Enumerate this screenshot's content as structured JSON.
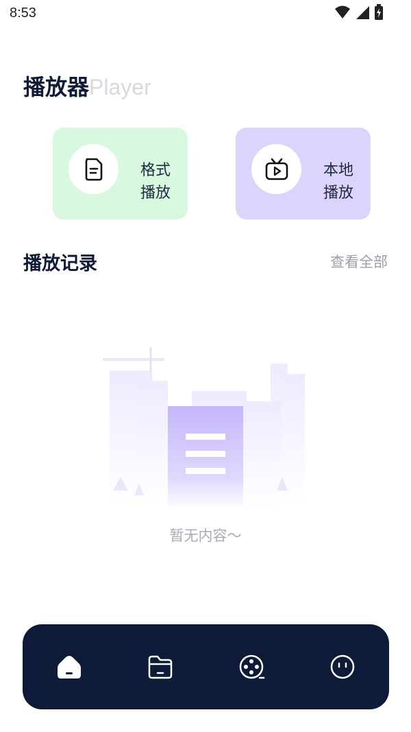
{
  "status": {
    "time": "8:53"
  },
  "header": {
    "title": "播放器",
    "subtitle": "Player"
  },
  "cards": [
    {
      "line1": "格式",
      "line2": "播放",
      "icon": "document-icon",
      "color": "#d8f9e0"
    },
    {
      "line1": "本地",
      "line2": "播放",
      "icon": "tv-icon",
      "color": "#ddd4fd"
    }
  ],
  "history": {
    "title": "播放记录",
    "view_all": "查看全部",
    "empty_text": "暂无内容～"
  },
  "nav": {
    "items": [
      "home-icon",
      "folder-icon",
      "film-reel-icon",
      "face-icon"
    ],
    "active": 0
  },
  "colors": {
    "dark": "#0e1b38",
    "muted": "#9a9ea8"
  }
}
